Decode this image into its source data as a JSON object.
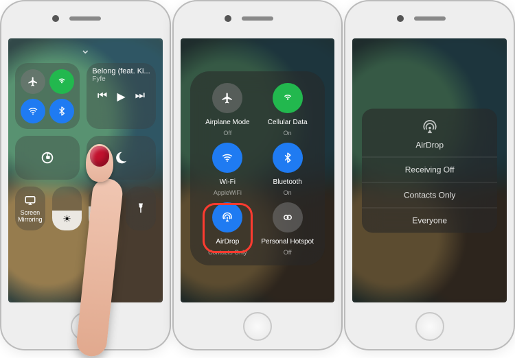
{
  "phone1": {
    "music": {
      "title": "Belong (feat. Ki...",
      "artist": "Fyfe"
    },
    "screen_mirroring_label": "Screen Mirroring",
    "connectivity": {
      "airplane": {
        "on": false
      },
      "cellular": {
        "on": true
      },
      "wifi": {
        "on": true
      },
      "bluetooth": {
        "on": true
      }
    }
  },
  "phone2": {
    "items": [
      {
        "key": "airplane",
        "label": "Airplane Mode",
        "sub": "Off",
        "color": "gray"
      },
      {
        "key": "cellular",
        "label": "Cellular Data",
        "sub": "On",
        "color": "green"
      },
      {
        "key": "wifi",
        "label": "Wi-Fi",
        "sub": "AppleWiFi",
        "color": "blue"
      },
      {
        "key": "bluetooth",
        "label": "Bluetooth",
        "sub": "On",
        "color": "blue"
      },
      {
        "key": "airdrop",
        "label": "AirDrop",
        "sub": "Contacts Only",
        "color": "blue",
        "highlighted": true
      },
      {
        "key": "hotspot",
        "label": "Personal Hotspot",
        "sub": "Off",
        "color": "gray"
      }
    ]
  },
  "phone3": {
    "title": "AirDrop",
    "options": [
      "Receiving Off",
      "Contacts Only",
      "Everyone"
    ]
  }
}
